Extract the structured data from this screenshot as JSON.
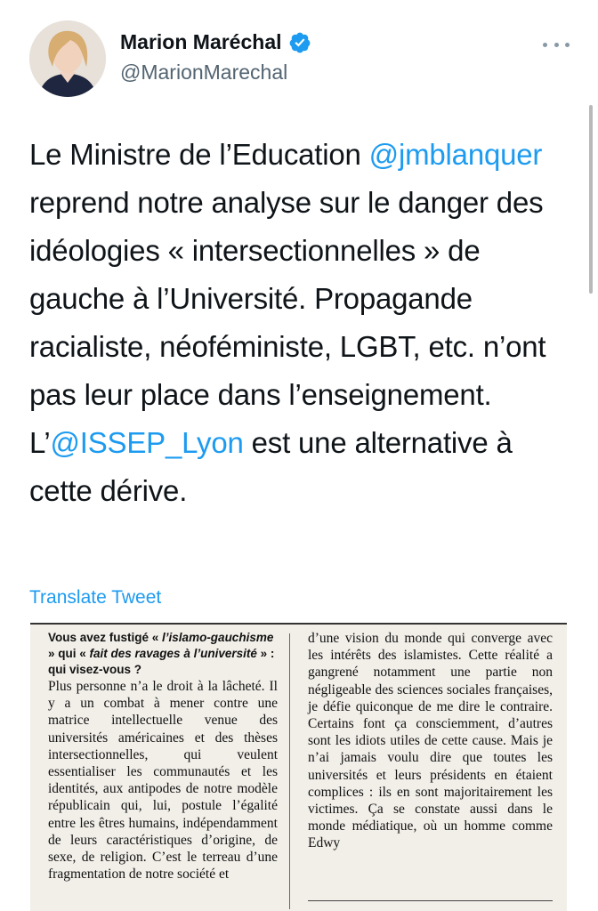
{
  "user": {
    "name": "Marion Maréchal",
    "handle": "@MarionMarechal",
    "avatar_icon": "profile-photo",
    "verified_icon": "verified-badge-icon"
  },
  "colors": {
    "accent": "#1d9bf0",
    "text": "#0f1419",
    "secondary": "#536471"
  },
  "tweet": {
    "part1": "Le Ministre de l’Education ",
    "mention1": "@jmblanquer",
    "part2": " reprend notre analyse sur le danger des idéologies « intersectionnelles » de gauche à l’Université. Propagande racialiste, néoféministe, LGBT, etc. n’ont pas leur place dans l’enseignement. L’",
    "mention2": "@ISSEP_Lyon",
    "part3": " est une alternative à cette dérive."
  },
  "translate_label": "Translate Tweet",
  "clipping": {
    "question": {
      "a": "Vous avez fustigé « ",
      "b": "l’islamo-gauchisme",
      "c": " » qui « ",
      "d": "fait des ravages à l’université",
      "e": " » : qui visez-vous ?"
    },
    "left_text": "Plus personne n’a le droit à la lâcheté. Il y a un combat à mener contre une matrice intellectuelle venue des universités américaines et des thèses intersectionnelles, qui veulent essentialiser les communautés et les identités, aux antipodes de notre modèle républicain qui, lui, postule l’égalité entre les êtres humains, indépendamment de leurs caractéristiques d’origine, de sexe, de religion. C’est le terreau d’une fragmentation de notre société et",
    "right_text": "d’une vision du monde qui converge avec les intérêts des islamistes. Cette réalité a gangrené notamment une partie non négligeable des sciences sociales françaises, je défie quiconque de me dire le contraire. Certains font ça consciemment, d’autres sont les idiots utiles de cette cause. Mais je n’ai jamais voulu dire que toutes les universités et leurs présidents en étaient complices : ils en sont majoritairement les victimes. Ça se constate aussi dans le monde médiatique, où un homme comme Edwy"
  }
}
